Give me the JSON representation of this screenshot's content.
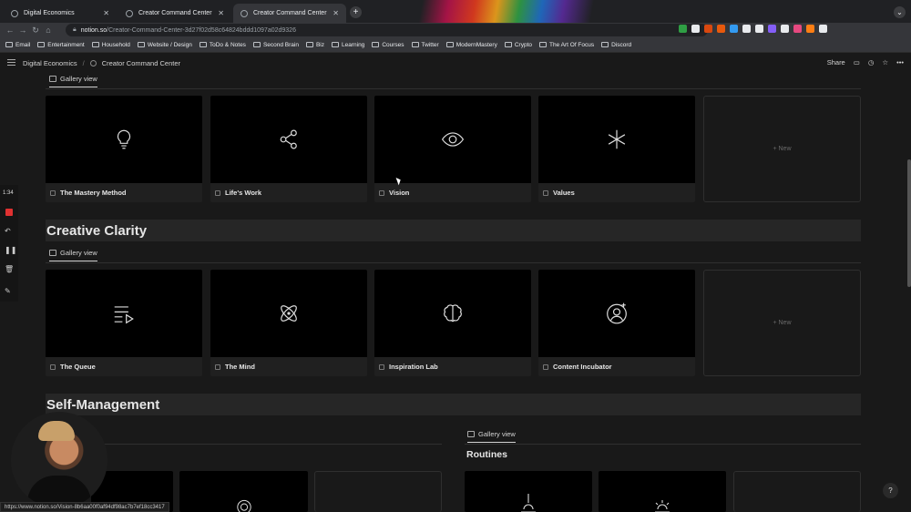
{
  "browser": {
    "tabs": [
      {
        "title": "Digital Economics",
        "active": false
      },
      {
        "title": "Creator Command Center",
        "active": false
      },
      {
        "title": "Creator Command Center",
        "active": true
      }
    ],
    "new_tab": "+",
    "url_host": "notion.so",
    "url_path": "/Creator-Command-Center-3d27f02d58c64824bddd1097a02d9326",
    "bookmarks": [
      "Email",
      "Entertainment",
      "Household",
      "Website / Design",
      "ToDo & Notes",
      "Second Brain",
      "Biz",
      "Learning",
      "Courses",
      "Twitter",
      "ModernMastery",
      "Crypto",
      "The Art Of Focus",
      "Discord"
    ],
    "extension_colors": [
      "#2f9e44",
      "#e8eaed",
      "#d9480f",
      "#e8590c",
      "#339af0",
      "#e8eaed",
      "#e8eaed",
      "#845ef7",
      "#e8eaed",
      "#e64980",
      "#fd7e14",
      "#e8eaed"
    ]
  },
  "notion": {
    "breadcrumb": [
      "Digital Economics",
      "/",
      "Creator Command Center"
    ],
    "share": "Share",
    "sections": [
      {
        "view_label": "Gallery view",
        "cards": [
          {
            "title": "The Mastery Method",
            "icon": "lightbulb-icon"
          },
          {
            "title": "Life's Work",
            "icon": "share-nodes-icon"
          },
          {
            "title": "Vision",
            "icon": "eye-icon"
          },
          {
            "title": "Values",
            "icon": "asterisk-icon"
          }
        ],
        "new_label": "+ New"
      },
      {
        "heading": "Creative Clarity",
        "view_label": "Gallery view",
        "cards": [
          {
            "title": "The Queue",
            "icon": "playlist-icon"
          },
          {
            "title": "The Mind",
            "icon": "atom-icon"
          },
          {
            "title": "Inspiration Lab",
            "icon": "brain-icon"
          },
          {
            "title": "Content Incubator",
            "icon": "user-sparkle-icon"
          }
        ],
        "new_label": "+ New"
      },
      {
        "heading": "Self-Management",
        "view_label": "Gallery view",
        "subheading": "Routines"
      }
    ]
  },
  "recorder": {
    "time": "1:34"
  },
  "status_url": "https://www.notion.so/Vision-8b6aa00f0af94df98ac7b7ef18cc3417",
  "help": "?"
}
